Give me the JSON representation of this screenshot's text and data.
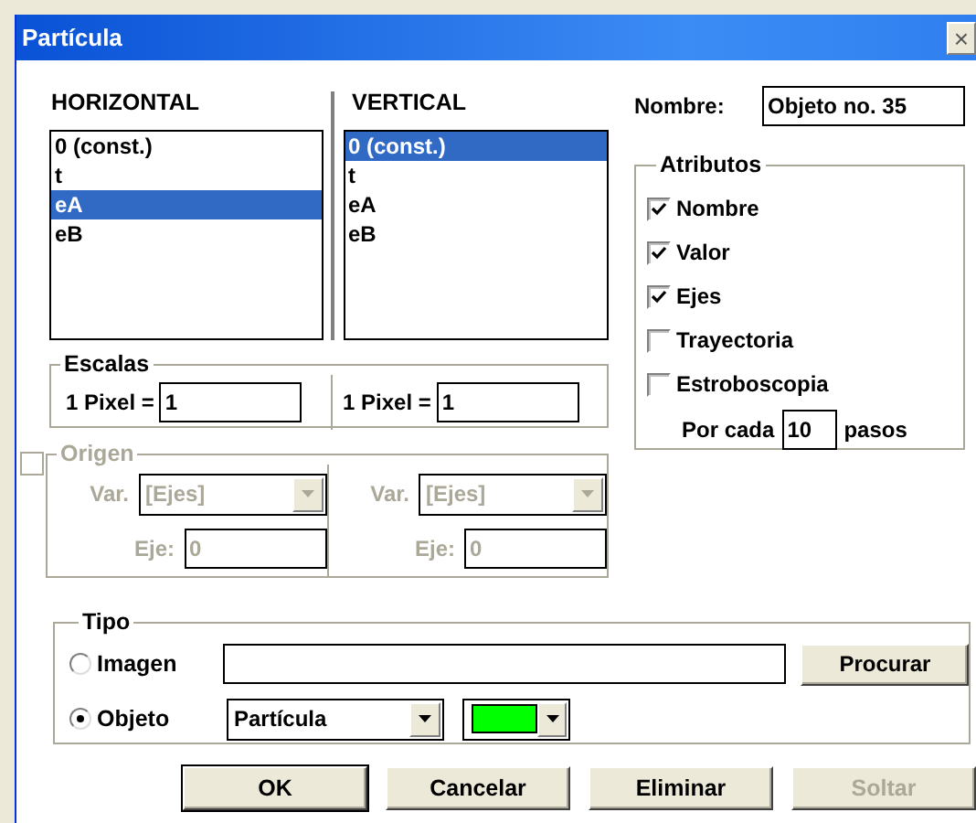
{
  "window": {
    "title": "Partícula",
    "close": "×"
  },
  "horizontal": {
    "heading": "HORIZONTAL",
    "items": [
      {
        "label": "0 (const.)",
        "selected": false
      },
      {
        "label": "t",
        "selected": false
      },
      {
        "label": "eA",
        "selected": true
      },
      {
        "label": "eB",
        "selected": false
      }
    ]
  },
  "vertical": {
    "heading": "VERTICAL",
    "items": [
      {
        "label": "0 (const.)",
        "selected": true
      },
      {
        "label": "t",
        "selected": false
      },
      {
        "label": "eA",
        "selected": false
      },
      {
        "label": "eB",
        "selected": false
      }
    ]
  },
  "name": {
    "label": "Nombre:",
    "value": "Objeto no. 35"
  },
  "attributes": {
    "title": "Atributos",
    "items": [
      {
        "label": "Nombre",
        "checked": true
      },
      {
        "label": "Valor",
        "checked": true
      },
      {
        "label": "Ejes",
        "checked": true
      },
      {
        "label": "Trayectoria",
        "checked": false
      },
      {
        "label": "Estroboscopia",
        "checked": false
      }
    ],
    "every": {
      "label": "Por cada",
      "value": "10",
      "unit": "pasos"
    }
  },
  "scales": {
    "title": "Escalas",
    "fields": [
      {
        "label": "1 Pixel =",
        "value": "1"
      },
      {
        "label": "1 Pixel =",
        "value": "1"
      }
    ]
  },
  "origin": {
    "title": "Origen",
    "checked": false,
    "disabled": true,
    "axes": [
      {
        "var_label": "Var.",
        "var_value": "[Ejes]",
        "axis_label": "Eje:",
        "axis_value": "0"
      },
      {
        "var_label": "Var.",
        "var_value": "[Ejes]",
        "axis_label": "Eje:",
        "axis_value": "0"
      }
    ]
  },
  "type": {
    "title": "Tipo",
    "options": [
      {
        "kind": "image",
        "label": "Imagen",
        "selected": false,
        "button": "Procurar"
      },
      {
        "kind": "object",
        "label": "Objeto",
        "selected": true,
        "shape": "Partícula",
        "color": "#00ff00"
      }
    ]
  },
  "buttons": [
    {
      "label": "OK",
      "default": true,
      "disabled": false
    },
    {
      "label": "Cancelar",
      "default": false,
      "disabled": false
    },
    {
      "label": "Eliminar",
      "default": false,
      "disabled": false
    },
    {
      "label": "Soltar",
      "default": false,
      "disabled": true
    }
  ]
}
